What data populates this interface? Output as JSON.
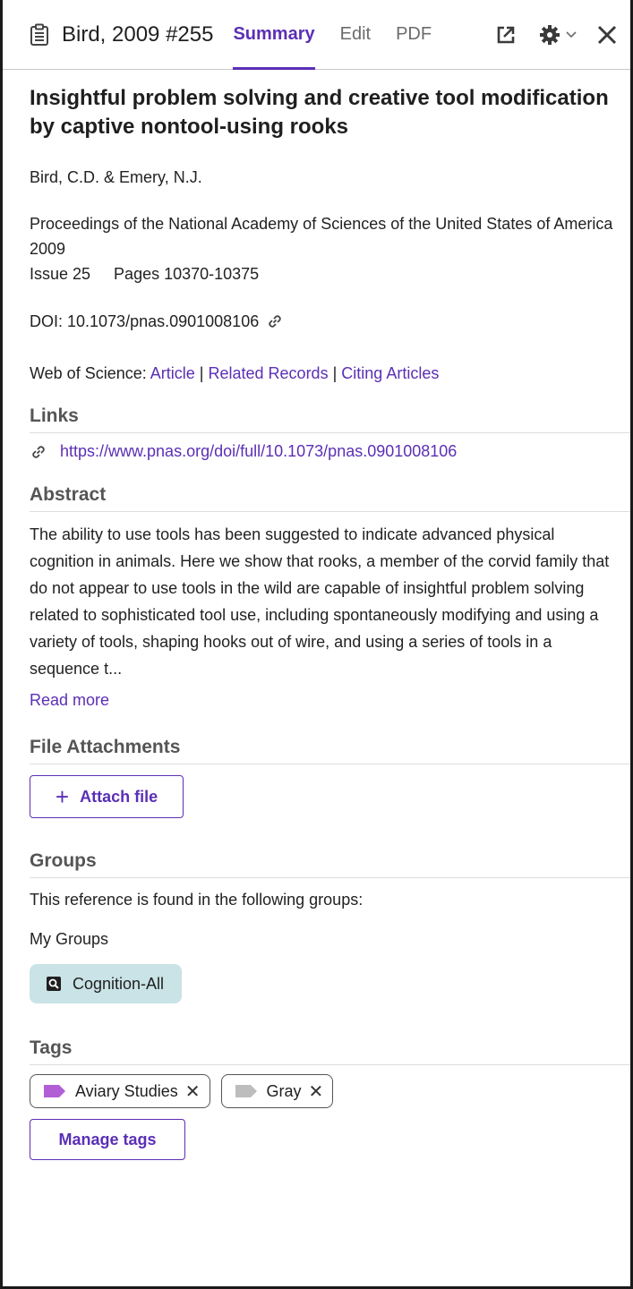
{
  "header": {
    "ref_title": "Bird, 2009 #255",
    "tabs": [
      {
        "label": "Summary",
        "active": true
      },
      {
        "label": "Edit",
        "active": false
      },
      {
        "label": "PDF",
        "active": false
      }
    ],
    "icons": [
      "clipboard-icon",
      "open-external-icon",
      "gear-icon",
      "chevron-down-icon",
      "close-icon"
    ]
  },
  "reference": {
    "title": "Insightful problem solving and creative tool modification by captive nontool-using rooks",
    "authors": "Bird, C.D. & Emery, N.J.",
    "journal": "Proceedings of the National Academy of Sciences of the United States of America",
    "year": "2009",
    "issue": "Issue 25",
    "pages": "Pages 10370-10375",
    "doi": "DOI: 10.1073/pnas.0901008106",
    "wos_label": "Web of Science:",
    "wos_links": [
      "Article",
      "Related Records",
      "Citing Articles"
    ],
    "wos_separator": "|"
  },
  "links": {
    "heading": "Links",
    "url": "https://www.pnas.org/doi/full/10.1073/pnas.0901008106"
  },
  "abstract": {
    "heading": "Abstract",
    "text": "The ability to use tools has been suggested to indicate advanced physical cognition in animals. Here we show that rooks, a member of the corvid family that do not appear to use tools in the wild are capable of insightful problem solving related to sophisticated tool use, including spontaneously modifying and using a variety of tools, shaping hooks out of wire, and using a series of tools in a sequence t...",
    "read_more": "Read more"
  },
  "files": {
    "heading": "File Attachments",
    "attach_plus": "+",
    "attach_label": "Attach file"
  },
  "groups": {
    "heading": "Groups",
    "description": "This reference is found in the following groups:",
    "subheading": "My Groups",
    "items": [
      {
        "label": "Cognition-All"
      }
    ],
    "chip_color": "#c9e3e6"
  },
  "tags": {
    "heading": "Tags",
    "items": [
      {
        "label": "Aviary Studies",
        "color": "#b25fd6"
      },
      {
        "label": "Gray",
        "color": "#bdbdbd"
      }
    ],
    "remove_glyph": "✕",
    "manage_label": "Manage tags"
  },
  "colors": {
    "accent": "#5b2fb5"
  }
}
